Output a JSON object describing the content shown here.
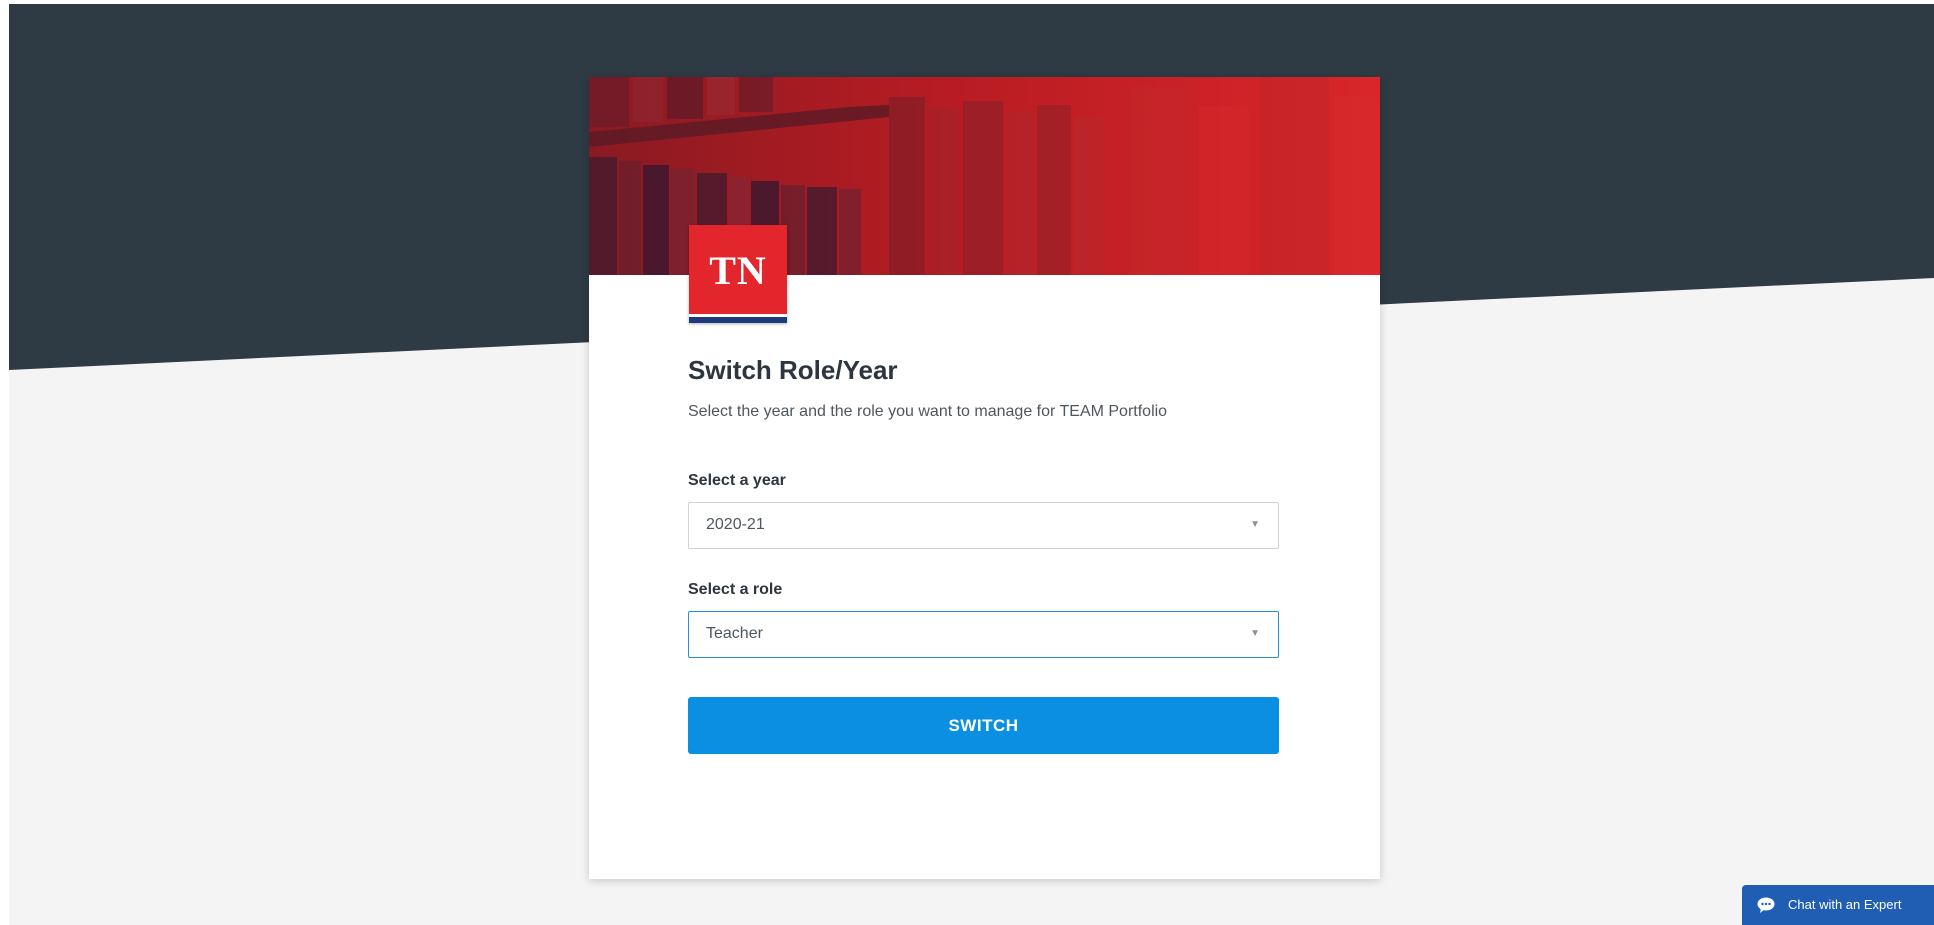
{
  "logo": {
    "text": "TN"
  },
  "form": {
    "title": "Switch Role/Year",
    "subtitle": "Select the year and the role you want to manage for TEAM Portfolio",
    "year": {
      "label": "Select a year",
      "value": "2020-21"
    },
    "role": {
      "label": "Select a role",
      "value": "Teacher"
    },
    "submit_label": "SWITCH"
  },
  "chat": {
    "label": "Chat with an Expert"
  },
  "colors": {
    "dark_band": "#2e3a44",
    "brand_red": "#e3262b",
    "primary_blue": "#0a8fe3",
    "chat_blue": "#1f5eb3"
  }
}
